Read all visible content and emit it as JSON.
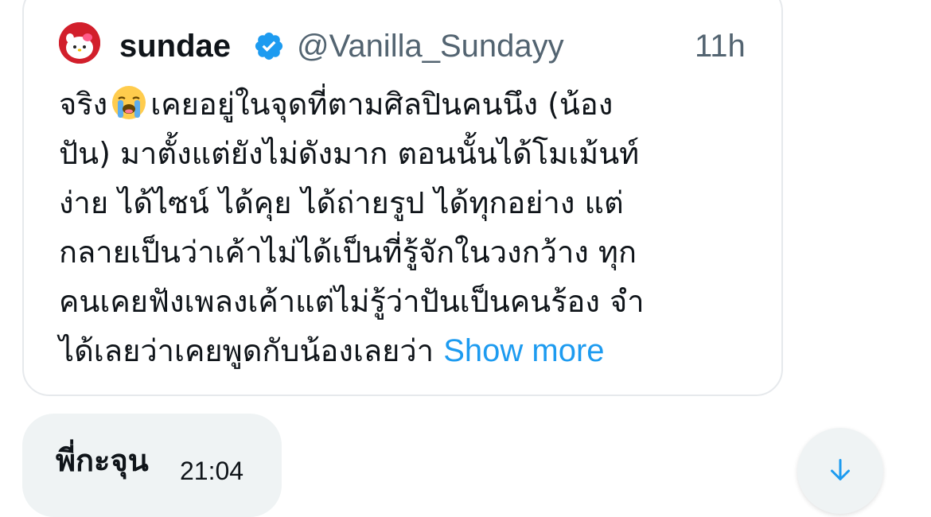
{
  "quoted_tweet": {
    "avatar_icon": "hello-kitty-avatar-icon",
    "display_name": "sundae",
    "verified_icon": "verified-badge-icon",
    "handle": "@Vanilla_Sundayy",
    "time_ago": "11h",
    "emoji_icon": "loudly-crying-face-emoji",
    "line1_a": "จริง",
    "line1_b": "เคยอยู่ในจุดที่ตามศิลปินคนนึง (น้อง",
    "line2": "ปัน) มาตั้งแต่ยังไม่ดังมาก ตอนนั้นได้โมเม้นท์",
    "line3": "ง่าย ได้ไซน์ ได้คุย ได้ถ่ายรูป ได้ทุกอย่าง แต่",
    "line4": "กลายเป็นว่าเค้าไม่ได้เป็นที่รู้จักในวงกว้าง ทุก",
    "line5": "คนเคยฟังเพลงเค้าแต่ไม่รู้ว่าปันเป็นคนร้อง จำ",
    "line6": "ได้เลยว่าเคยพูดกับน้องเลยว่า",
    "show_more": "Show more"
  },
  "message": {
    "text": "พี่กะจุน",
    "time": "21:04"
  },
  "scroll_button": {
    "icon": "arrow-down-icon"
  },
  "colors": {
    "link": "#1d9bf0",
    "secondary_text": "#536471",
    "bubble_bg": "#eff3f4",
    "card_border": "#e6e9ec"
  }
}
